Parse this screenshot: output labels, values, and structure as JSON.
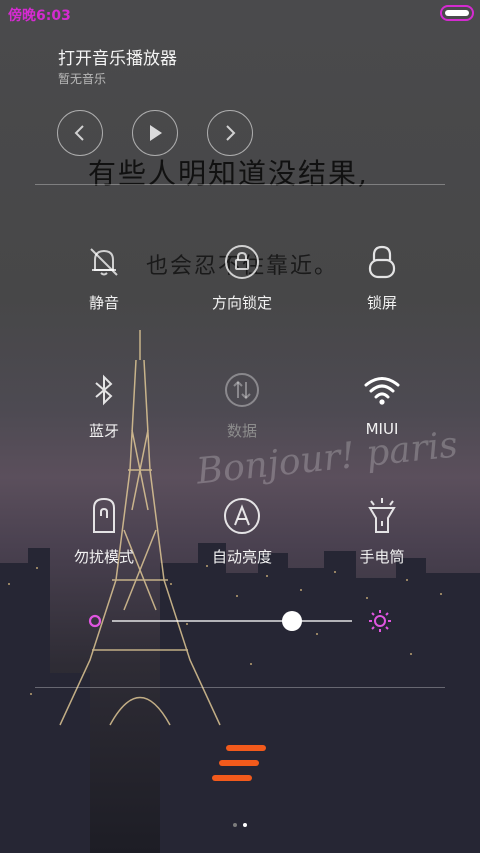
{
  "status": {
    "time": "傍晚6:03",
    "battery_level": 1.0
  },
  "music": {
    "title": "打开音乐播放器",
    "subtitle": "暂无音乐",
    "prev_icon": "chevron-left-icon",
    "play_icon": "play-icon",
    "next_icon": "chevron-right-icon"
  },
  "wallpaper": {
    "lyric_line1": "有些人明知道没结果,",
    "lyric_line2": "也会忍不住靠近。",
    "script_text": "Bonjour! paris"
  },
  "toggles": [
    {
      "id": "mute",
      "label": "静音",
      "icon": "bell-off-icon",
      "enabled": false
    },
    {
      "id": "rotation-lock",
      "label": "方向锁定",
      "icon": "rotation-lock-icon",
      "enabled": false
    },
    {
      "id": "lock-screen",
      "label": "锁屏",
      "icon": "lock-icon",
      "enabled": false
    },
    {
      "id": "bluetooth",
      "label": "蓝牙",
      "icon": "bluetooth-icon",
      "enabled": false
    },
    {
      "id": "data",
      "label": "数据",
      "icon": "mobile-data-icon",
      "enabled": false
    },
    {
      "id": "wifi",
      "label": "MIUI",
      "icon": "wifi-icon",
      "enabled": true
    },
    {
      "id": "dnd",
      "label": "勿扰模式",
      "icon": "do-not-disturb-icon",
      "enabled": false
    },
    {
      "id": "auto-brightness",
      "label": "自动亮度",
      "icon": "auto-brightness-icon",
      "enabled": false
    },
    {
      "id": "flashlight",
      "label": "手电筒",
      "icon": "flashlight-icon",
      "enabled": false
    }
  ],
  "brightness": {
    "level": 0.75,
    "min_icon": "brightness-low-icon",
    "max_icon": "brightness-high-icon"
  },
  "menu_icon": "hamburger-menu-icon",
  "accent_colors": {
    "status": "#d42bd0",
    "menu": "#f25a1c",
    "slider_icon": "#e055e0"
  },
  "pager": {
    "pages": 2,
    "current": 2
  }
}
